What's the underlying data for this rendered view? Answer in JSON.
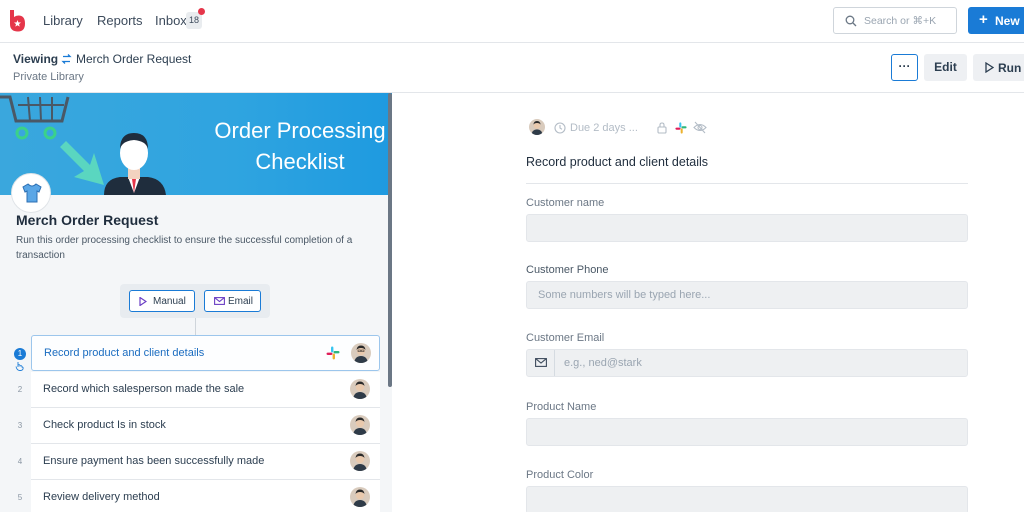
{
  "nav": {
    "links": [
      "Library",
      "Reports",
      "Inbox"
    ],
    "inbox_count": "18",
    "search_placeholder": "Search or ⌘+K",
    "new_label": "New"
  },
  "subheader": {
    "viewing_label": "Viewing",
    "workflow_title": "Merch Order Request",
    "library_name": "Private Library",
    "more_label": "···",
    "edit_label": "Edit",
    "run_label": "Run Workflow"
  },
  "workflow": {
    "banner_line1": "Order Processing",
    "banner_line2": "Checklist",
    "name": "Merch Order Request",
    "description": "Run this order processing checklist to ensure the successful completion of a transaction",
    "triggers": [
      "Manual",
      "Email"
    ],
    "tasks": [
      {
        "num": "1",
        "label": "Record product and client details",
        "active": true
      },
      {
        "num": "2",
        "label": "Record which salesperson made the sale",
        "active": false
      },
      {
        "num": "3",
        "label": "Check product Is in stock",
        "active": false
      },
      {
        "num": "4",
        "label": "Ensure payment has been successfully made",
        "active": false
      },
      {
        "num": "5",
        "label": "Review delivery method",
        "active": false
      }
    ]
  },
  "detail": {
    "due": "Due 2 days ...",
    "heading": "Record product and client details",
    "fields": [
      {
        "label": "Customer name",
        "placeholder": "",
        "type": "text"
      },
      {
        "label": "Customer Phone",
        "placeholder": "Some numbers will be typed here...",
        "type": "text"
      },
      {
        "label": "Customer Email",
        "placeholder": "e.g., ned@stark",
        "type": "email"
      },
      {
        "label": "Product Name",
        "placeholder": "",
        "type": "text"
      },
      {
        "label": "Product Color",
        "placeholder": "",
        "type": "text"
      }
    ]
  },
  "colors": {
    "accent": "#1a7bd6",
    "banner": "#2fa4e0",
    "badge_dot": "#e5364a"
  }
}
